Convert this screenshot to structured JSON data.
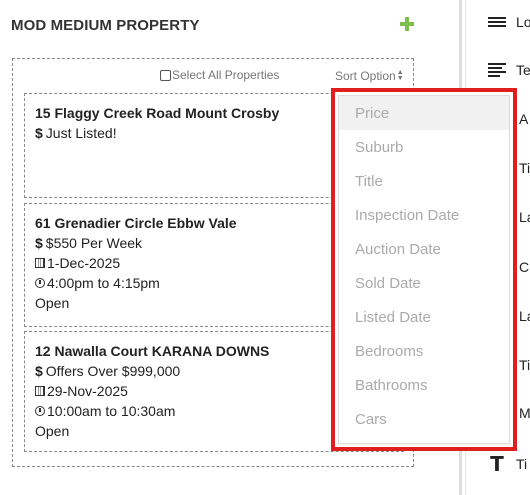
{
  "panel": {
    "title": "MOD MEDIUM PROPERTY",
    "select_all": "Select All Properties",
    "sort_label": "Sort Option"
  },
  "properties": [
    {
      "address": "15 Flaggy Creek Road Mount Crosby",
      "price": "Just Listed!"
    },
    {
      "address": "61 Grenadier Circle Ebbw Vale",
      "price": "$550 Per Week",
      "date": "1-Dec-2025",
      "time": "4:00pm to 4:15pm",
      "status": "Open"
    },
    {
      "address": "12 Nawalla Court KARANA DOWNS",
      "price": "Offers Over $999,000",
      "date": "29-Nov-2025",
      "time": "10:00am to 10:30am",
      "status": "Open"
    }
  ],
  "icons": {
    "add": "plus-icon",
    "dollar": "$",
    "calendar": "calendar-icon",
    "clock": "clock-icon",
    "sort": "sort-icon"
  },
  "sort_options": [
    "Price",
    "Suburb",
    "Title",
    "Inspection Date",
    "Auction Date",
    "Sold Date",
    "Listed Date",
    "Bedrooms",
    "Bathrooms",
    "Cars"
  ],
  "sort_selected": "Price",
  "right_panel": {
    "items": [
      "Lo",
      "Te",
      "A",
      "Ti",
      "La",
      "C",
      "La",
      "Ti",
      "M",
      "Ti"
    ]
  },
  "colors": {
    "accent_green": "#7cc04b",
    "highlight_red": "#e01e1e",
    "option_text": "#aaaaaa"
  }
}
